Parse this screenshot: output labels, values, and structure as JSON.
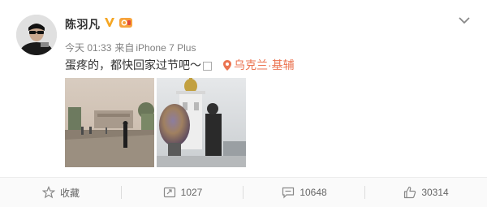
{
  "post": {
    "username": "陈羽凡",
    "time": "今天 01:33",
    "source_prefix": "来自",
    "source_device": "iPhone 7 Plus",
    "text": "蛋疼的，都快回家过节吧～",
    "location": "乌克兰·基辅"
  },
  "actions": {
    "favorite_label": "收藏",
    "repost_count": "1027",
    "comment_count": "10648",
    "like_count": "30314"
  },
  "icons": {
    "verified": "verified-v-icon",
    "medal": "medal-icon",
    "menu": "chevron-down-icon",
    "location": "location-pin-icon",
    "favorite": "star-icon",
    "repost": "repost-icon",
    "comment": "comment-icon",
    "like": "thumbs-up-icon"
  },
  "colors": {
    "accent": "#eb7350",
    "verified": "#f5a623",
    "text": "#333333",
    "meta": "#808080"
  }
}
